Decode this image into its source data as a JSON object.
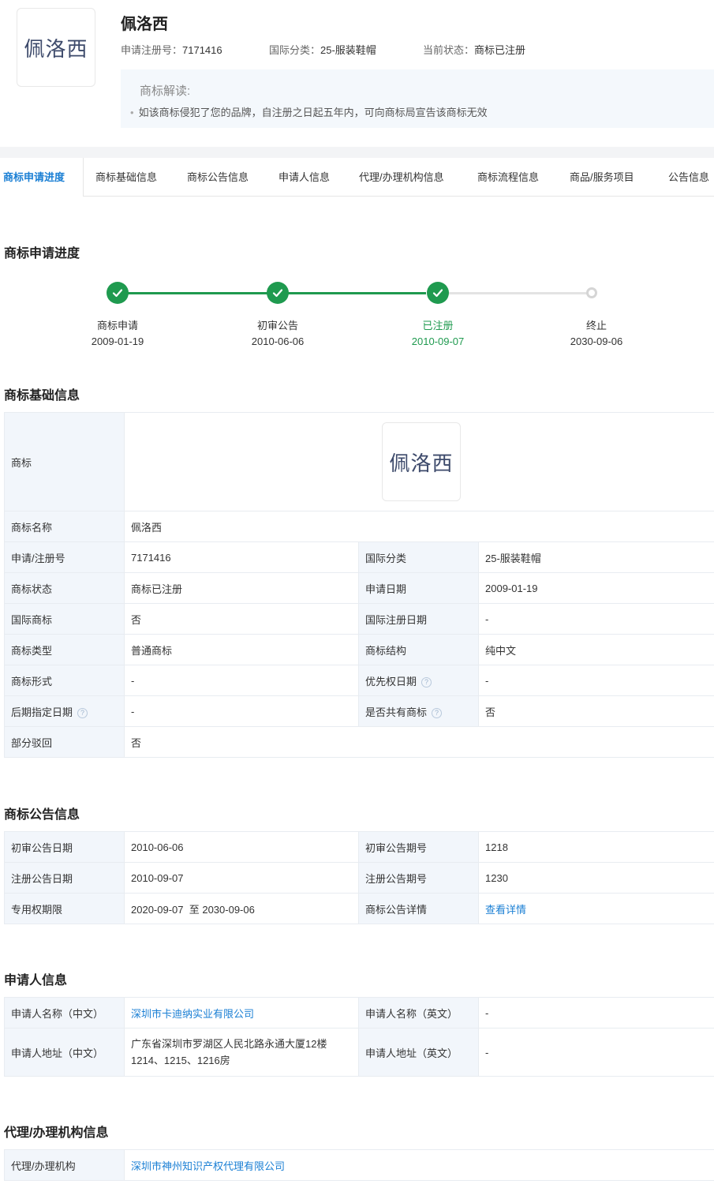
{
  "header": {
    "logo_text": "佩洛西",
    "title": "佩洛西",
    "reg_no_label": "申请注册号：",
    "reg_no": "7171416",
    "class_label": "国际分类：",
    "class_value": "25-服装鞋帽",
    "status_label": "当前状态：",
    "status_value": "商标已注册",
    "interpret_title": "商标解读:",
    "interpret_item": "如该商标侵犯了您的品牌，自注册之日起五年内，可向商标局宣告该商标无效"
  },
  "tabs": [
    "商标申请进度",
    "商标基础信息",
    "商标公告信息",
    "申请人信息",
    "代理/办理机构信息",
    "商标流程信息",
    "商品/服务项目",
    "公告信息"
  ],
  "progress": {
    "title": "商标申请进度",
    "steps": [
      {
        "label": "商标申请",
        "date": "2009-01-19"
      },
      {
        "label": "初审公告",
        "date": "2010-06-06"
      },
      {
        "label": "已注册",
        "date": "2010-09-07"
      },
      {
        "label": "终止",
        "date": "2030-09-06"
      }
    ]
  },
  "basic": {
    "title": "商标基础信息",
    "logo_label": "商标",
    "logo_text": "佩洛西",
    "name_label": "商标名称",
    "name_value": "佩洛西",
    "rows": [
      [
        "申请/注册号",
        "7171416",
        "国际分类",
        "25-服装鞋帽"
      ],
      [
        "商标状态",
        "商标已注册",
        "申请日期",
        "2009-01-19"
      ],
      [
        "国际商标",
        "否",
        "国际注册日期",
        "-"
      ],
      [
        "商标类型",
        "普通商标",
        "商标结构",
        "纯中文"
      ],
      [
        "商标形式",
        "-",
        "优先权日期",
        "-"
      ],
      [
        "后期指定日期",
        "-",
        "是否共有商标",
        "否"
      ]
    ],
    "partial_label": "部分驳回",
    "partial_value": "否",
    "help_glyph": "?"
  },
  "announce": {
    "title": "商标公告信息",
    "rows": [
      [
        "初审公告日期",
        "2010-06-06",
        "初审公告期号",
        "1218"
      ],
      [
        "注册公告日期",
        "2010-09-07",
        "注册公告期号",
        "1230"
      ],
      [
        "专用权期限",
        "2020-09-07  至 2030-09-06",
        "商标公告详情",
        "查看详情"
      ]
    ]
  },
  "applicant": {
    "title": "申请人信息",
    "name_cn_label": "申请人名称（中文）",
    "name_cn": "深圳市卡迪纳实业有限公司",
    "name_en_label": "申请人名称（英文）",
    "name_en": "-",
    "addr_cn_label": "申请人地址（中文）",
    "addr_cn": "广东省深圳市罗湖区人民北路永通大厦12楼1214、1215、1216房",
    "addr_en_label": "申请人地址（英文）",
    "addr_en": "-"
  },
  "agency": {
    "title": "代理/办理机构信息",
    "label": "代理/办理机构",
    "value": "深圳市神州知识产权代理有限公司"
  },
  "colors": {
    "accent": "#1a7fd4",
    "success": "#1f9a4f",
    "label_bg": "#f2f6fb"
  }
}
